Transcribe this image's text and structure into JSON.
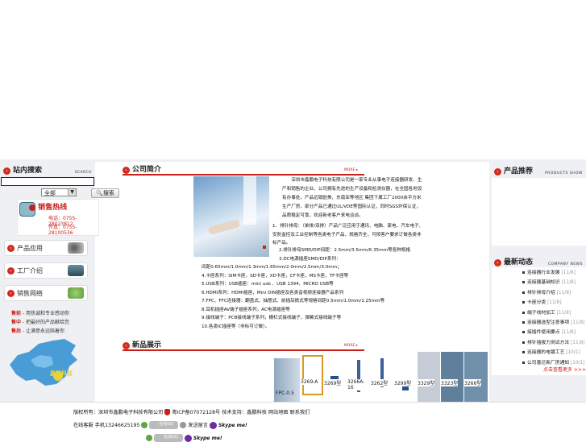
{
  "left": {
    "search_title": "站内搜索",
    "search_en": "SEARCH",
    "search_placeholder": "",
    "select_value": "全部",
    "search_button": "搜索",
    "hotline_title": "销售热线",
    "phone": "电话：0755-28023812",
    "fax": "传真：0755-28100536",
    "menu": [
      {
        "label": "产品应用"
      },
      {
        "label": "工厂介绍"
      },
      {
        "label": "销售网络"
      }
    ],
    "promo": [
      {
        "k": "售前",
        "v": " - 用热诚和专业感动你"
      },
      {
        "k": "售中",
        "v": " - 把最好的产品献给您"
      },
      {
        "k": "售后",
        "v": " - 让满意永远陪着你"
      }
    ],
    "map_label": "鑫鹏科技"
  },
  "middle": {
    "intro_title": "公司简介",
    "more": "MORE",
    "intro_text": "　　深圳市鑫鹏电子科技有限公司是一家专业从事电子连接器研发、生产和销售的企业，公司拥有先进的生产设备和检测仪器，在全国各地设有办事处，产品远销欧美、东南亚等地区 集团下属工厂2000余平方米生产厂房，部分产品已通过UL/VDE等国际认证，同时SGS环保认证，品质稳定可靠，欢迎新老客户来电洽谈。",
    "lines": [
      "1．排针排母：（单排/双排）产品广泛应用于通讯、电脑、家电、汽车电子、安防监控及工业控制等各类电子产品，规格齐全，可按客户要求订做各类非标产品。",
      "2.排针排母SMD/DIP间距：2.5mm/3.5mm/6.35mm等各种规格",
      "3.DC电源插座SMD/DIP系列：",
      "间距0.65mm/1.0mm/1.3mm/1.65mm/2.0mm/2.5mm/3.0mm；",
      "4.卡座系列：SIM卡座，SD卡座，XD卡座，CF卡座，MS卡座，TF卡座等",
      "5.USB系列：USB插座：mini usb 、USB 1394、MICRO USB等",
      "6.HDMI系列：HDMI插座，Mini DIN插座及各类音视频连接器产品系列",
      "7.FPC、FFC连接器：翻盖式、抽屉式、前插后掀式等规格间距0.5mm/1.0mm/1.25mm等",
      "8.耳机插座AV端子插座系列，AC电源插座等",
      "9.接线端子：PCB接线端子系列，栅栏式接线端子，弹簧式接线端子等",
      "10.各类IC插座等（非标可订做）。"
    ],
    "products_title": "新品展示",
    "products": [
      {
        "label": "FPC-0.5"
      },
      {
        "label": "3269-A"
      },
      {
        "label": "3269型"
      },
      {
        "label": "3266A-16"
      },
      {
        "label": "3262型"
      },
      {
        "label": "3299型"
      },
      {
        "label": "3329型"
      },
      {
        "label": "3323型"
      },
      {
        "label": "3266型"
      }
    ]
  },
  "right": {
    "rec_title": "产品推荐",
    "rec_en": "PRODUCTS SHOW",
    "news_title": "最新动态",
    "news_en": "COMPANY NEWS",
    "news": [
      {
        "title": "连接器行业发展",
        "date": "[11/8]"
      },
      {
        "title": "连接器基础知识",
        "date": "[11/8]"
      },
      {
        "title": "排针排母介绍",
        "date": "[11/8]"
      },
      {
        "title": "卡座分类",
        "date": "[11/8]"
      },
      {
        "title": "端子线材加工",
        "date": "[11/8]"
      },
      {
        "title": "连接器选型注意事项",
        "date": "[11/8]"
      },
      {
        "title": "接插件使用要点",
        "date": "[11/8]"
      },
      {
        "title": "排针插拔力测试方法",
        "date": "[11/8]"
      },
      {
        "title": "连接器的电镀工艺",
        "date": "[10/1]"
      },
      {
        "title": "公司喜迁新厂房通知",
        "date": "[10/1]"
      }
    ],
    "more_news": "点击查看更多 >>>"
  },
  "footer": {
    "line1_a": "版权所有：深圳市鑫鹏电子科技有限公司",
    "line1_b": "粤ICP备07072128号",
    "line1_c": "技术支持：鑫鹏科技",
    "line1_d": "网站地图",
    "line1_e": "联系我们",
    "line2_a": "在线客服 手机13246625195",
    "qq_label": "在线QQ",
    "msg_label": "发送留言",
    "skype": "Skype me!"
  },
  "colors": {
    "accent": "#c8211a",
    "panel": "#eef0f3"
  }
}
